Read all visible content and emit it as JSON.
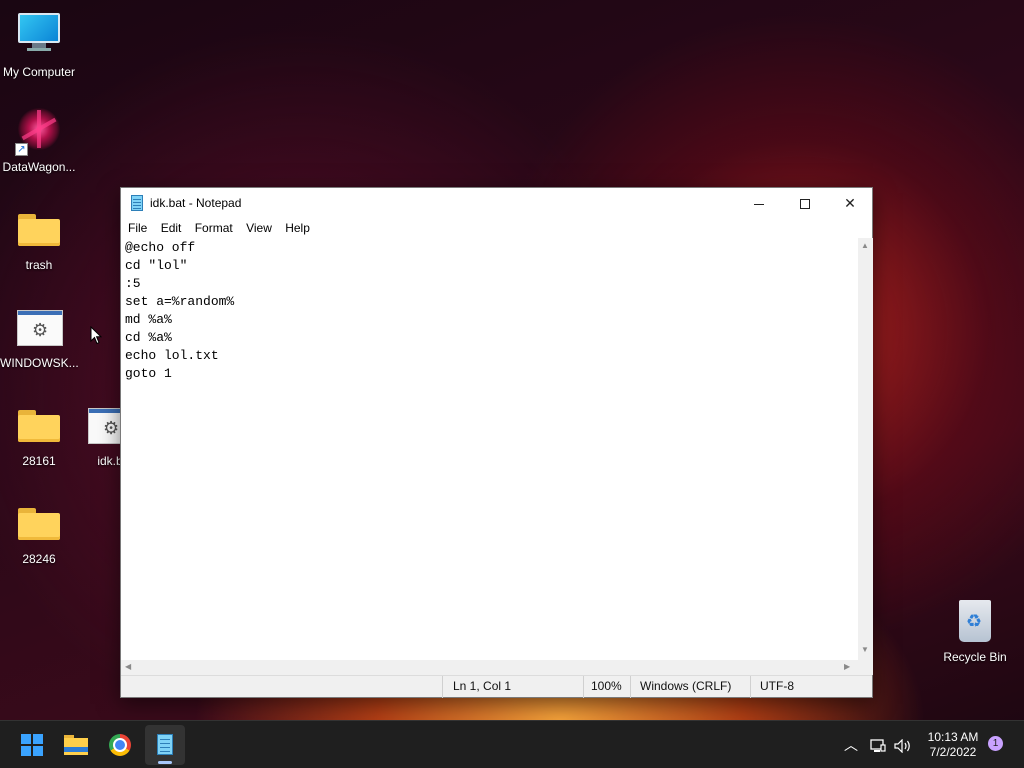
{
  "desktop": {
    "icons": [
      {
        "label": "My Computer"
      },
      {
        "label": "DataWagon..."
      },
      {
        "label": "trash"
      },
      {
        "label": "WINDOWSK..."
      },
      {
        "label": "28161"
      },
      {
        "label": "idk.b"
      },
      {
        "label": "28246"
      },
      {
        "label": "Recycle Bin"
      }
    ]
  },
  "window": {
    "title": "idk.bat - Notepad",
    "menu": [
      "File",
      "Edit",
      "Format",
      "View",
      "Help"
    ],
    "content": "@echo off\ncd \"lol\"\n:5\nset a=%random%\nmd %a%\ncd %a%\necho lol.txt\ngoto 1",
    "status": {
      "position": "Ln 1, Col 1",
      "zoom": "100%",
      "line_ending": "Windows (CRLF)",
      "encoding": "UTF-8"
    }
  },
  "taskbar": {
    "clock": {
      "time": "10:13 AM",
      "date": "7/2/2022"
    },
    "notification_count": "1"
  },
  "colors": {
    "accent": "#3aa3ff",
    "taskbar": "#1f1f1f",
    "active_indicator": "#a8c7fa"
  }
}
